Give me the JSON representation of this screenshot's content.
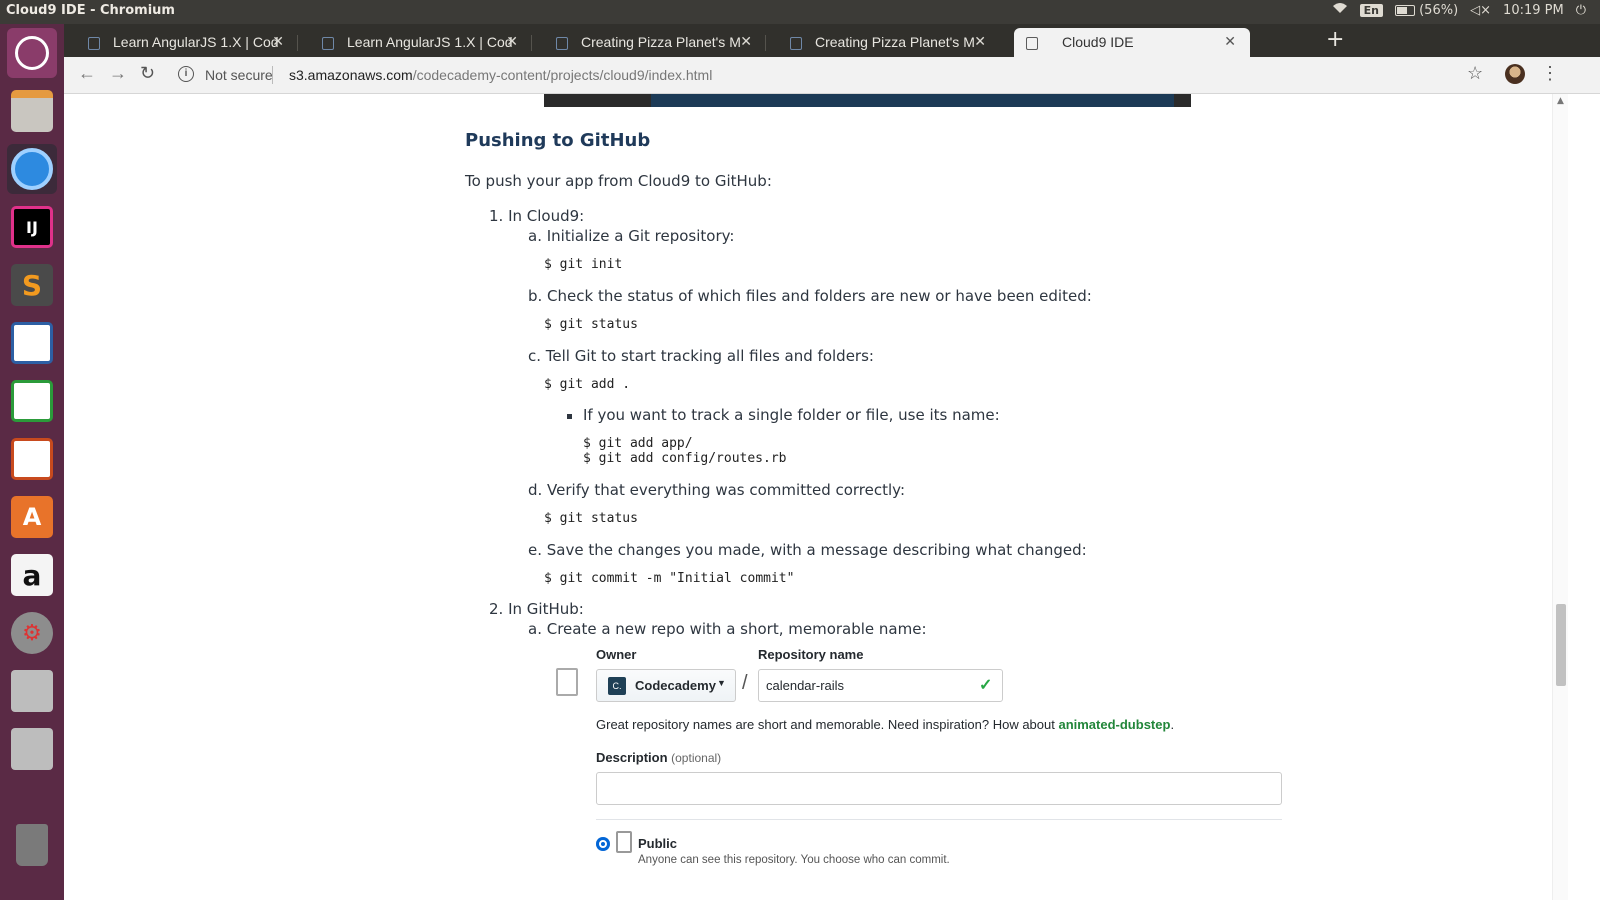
{
  "system": {
    "window_title": "Cloud9 IDE - Chromium",
    "lang": "En",
    "battery": "(56%)",
    "clock": "10:19 PM"
  },
  "launcher": {
    "items": [
      "ubuntu-dash",
      "files",
      "chromium",
      "intellij",
      "sublime-text",
      "libreoffice-writer",
      "libreoffice-calc",
      "libreoffice-impress",
      "software-center",
      "amazon",
      "system-settings",
      "disk-1",
      "disk-2",
      "trash"
    ]
  },
  "tabs": [
    {
      "label": "Learn AngularJS 1.X | Cod"
    },
    {
      "label": "Learn AngularJS 1.X | Cod"
    },
    {
      "label": "Creating Pizza Planet's M"
    },
    {
      "label": "Creating Pizza Planet's M"
    },
    {
      "label": "Cloud9 IDE"
    }
  ],
  "address": {
    "security": "Not secure",
    "host": "s3.amazonaws.com",
    "path": "/codecademy-content/projects/cloud9/index.html"
  },
  "article": {
    "heading": "Pushing to GitHub",
    "intro": "To push your app from Cloud9 to GitHub:",
    "step1": "1. In Cloud9:",
    "step1a": "a. Initialize a Git repository:",
    "code1a": "$ git init",
    "step1b": "b. Check the status of which files and folders are new or have been edited:",
    "code1b": "$ git status",
    "step1c": "c. Tell Git to start tracking all files and folders:",
    "code1c": "$ git add .",
    "bullet": "If you want to track a single folder or file, use its name:",
    "code_bullet": "$ git add app/\n$ git add config/routes.rb",
    "step1d": "d. Verify that everything was committed correctly:",
    "code1d": "$ git status",
    "step1e": "e. Save the changes you made, with a message describing what changed:",
    "code1e": "$ git commit -m \"Initial commit\"",
    "step2": "2. In GitHub:",
    "step2a": "a. Create a new repo with a short, memorable name:"
  },
  "github_form": {
    "owner_label": "Owner",
    "repo_label": "Repository name",
    "owner_value": "Codecademy",
    "repo_value": "calendar-rails",
    "hint": "Great repository names are short and memorable. Need inspiration? How about ",
    "hint_suggestion": "animated-dubstep",
    "description_label": "Description",
    "description_optional": "(optional)",
    "public_label": "Public",
    "public_desc": "Anyone can see this repository. You choose who can commit."
  }
}
